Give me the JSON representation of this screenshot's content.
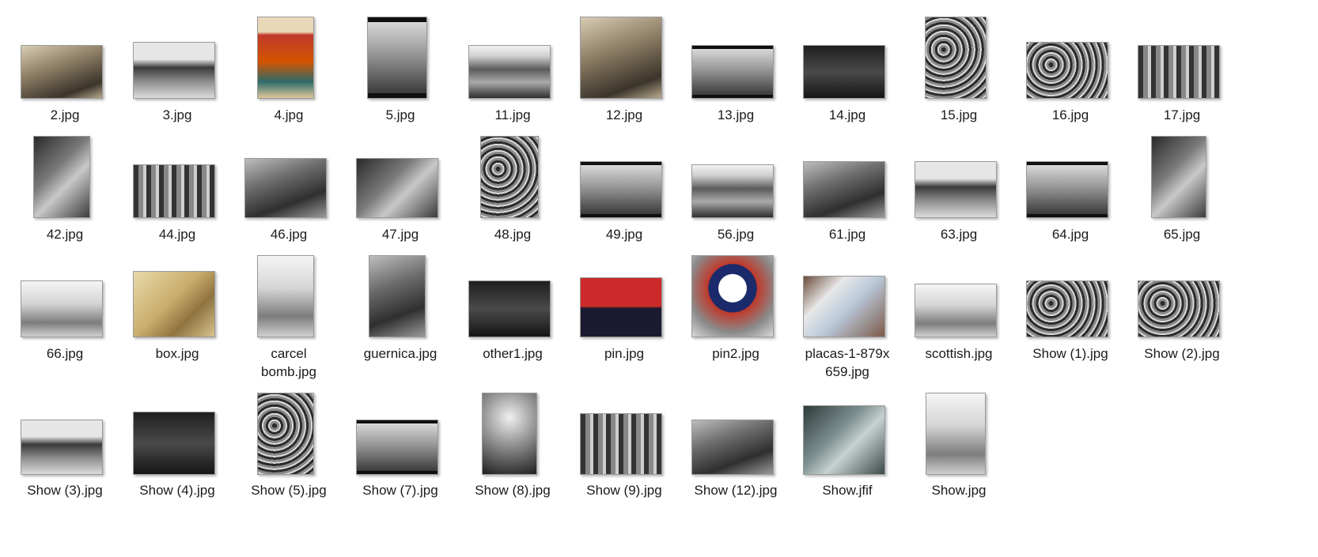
{
  "files": [
    {
      "name": "2.jpg",
      "thumb": "t-sepia"
    },
    {
      "name": "3.jpg",
      "thumb": "t-bw2"
    },
    {
      "name": "4.jpg",
      "thumb": "t-poster"
    },
    {
      "name": "5.jpg",
      "thumb": "t-framed"
    },
    {
      "name": "11.jpg",
      "thumb": "t-building"
    },
    {
      "name": "12.jpg",
      "thumb": "t-sepia"
    },
    {
      "name": "13.jpg",
      "thumb": "t-framed"
    },
    {
      "name": "14.jpg",
      "thumb": "t-dark"
    },
    {
      "name": "15.jpg",
      "thumb": "t-crowd"
    },
    {
      "name": "16.jpg",
      "thumb": "t-crowd"
    },
    {
      "name": "17.jpg",
      "thumb": "t-bw3"
    },
    {
      "name": "42.jpg",
      "thumb": "t-bw5"
    },
    {
      "name": "44.jpg",
      "thumb": "t-bw3"
    },
    {
      "name": "46.jpg",
      "thumb": "t-bw1"
    },
    {
      "name": "47.jpg",
      "thumb": "t-bw5"
    },
    {
      "name": "48.jpg",
      "thumb": "t-crowd"
    },
    {
      "name": "49.jpg",
      "thumb": "t-framed"
    },
    {
      "name": "56.jpg",
      "thumb": "t-building"
    },
    {
      "name": "61.jpg",
      "thumb": "t-bw1"
    },
    {
      "name": "63.jpg",
      "thumb": "t-bw2"
    },
    {
      "name": "64.jpg",
      "thumb": "t-framed"
    },
    {
      "name": "65.jpg",
      "thumb": "t-bw5"
    },
    {
      "name": "66.jpg",
      "thumb": "t-light"
    },
    {
      "name": "box.jpg",
      "thumb": "t-box"
    },
    {
      "name": "carcel\nbomb.jpg",
      "thumb": "t-light"
    },
    {
      "name": "guernica.jpg",
      "thumb": "t-bw1"
    },
    {
      "name": "other1.jpg",
      "thumb": "t-dark"
    },
    {
      "name": "pin.jpg",
      "thumb": "t-pin"
    },
    {
      "name": "pin2.jpg",
      "thumb": "t-pin2"
    },
    {
      "name": "placas-1-879x\n659.jpg",
      "thumb": "t-placas"
    },
    {
      "name": "scottish.jpg",
      "thumb": "t-light"
    },
    {
      "name": "Show (1).jpg",
      "thumb": "t-crowd"
    },
    {
      "name": "Show (2).jpg",
      "thumb": "t-crowd"
    },
    {
      "name": "Show (3).jpg",
      "thumb": "t-bw2"
    },
    {
      "name": "Show (4).jpg",
      "thumb": "t-dark"
    },
    {
      "name": "Show (5).jpg",
      "thumb": "t-crowd"
    },
    {
      "name": "Show (7).jpg",
      "thumb": "t-framed"
    },
    {
      "name": "Show (8).jpg",
      "thumb": "t-bw4"
    },
    {
      "name": "Show (9).jpg",
      "thumb": "t-bw3"
    },
    {
      "name": "Show (12).jpg",
      "thumb": "t-bw1"
    },
    {
      "name": "Show.jfif",
      "thumb": "t-teal"
    },
    {
      "name": "Show.jpg",
      "thumb": "t-light"
    }
  ]
}
